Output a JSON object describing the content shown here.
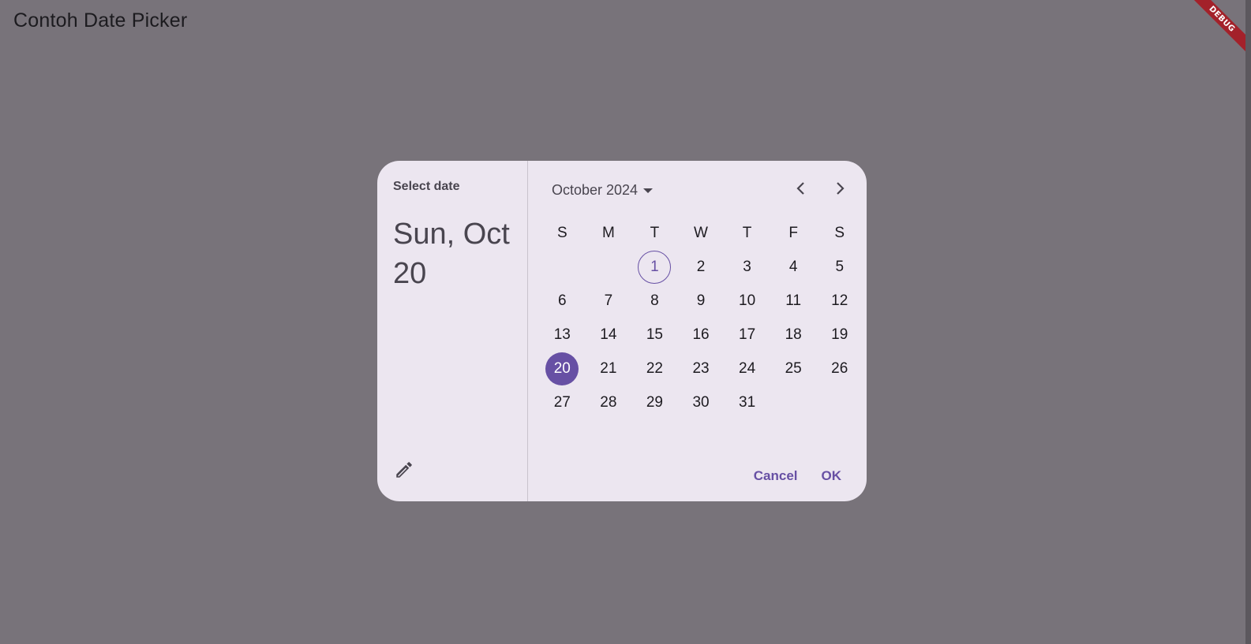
{
  "app": {
    "title": "Contoh Date Picker",
    "debug_banner": "DEBUG"
  },
  "dialog": {
    "help_text": "Select date",
    "headline": "Sun, Oct 20",
    "month_label": "October 2024",
    "weekdays": [
      "S",
      "M",
      "T",
      "W",
      "T",
      "F",
      "S"
    ],
    "weeks": [
      [
        "",
        "",
        "1",
        "2",
        "3",
        "4",
        "5"
      ],
      [
        "6",
        "7",
        "8",
        "9",
        "10",
        "11",
        "12"
      ],
      [
        "13",
        "14",
        "15",
        "16",
        "17",
        "18",
        "19"
      ],
      [
        "20",
        "21",
        "22",
        "23",
        "24",
        "25",
        "26"
      ],
      [
        "27",
        "28",
        "29",
        "30",
        "31",
        "",
        ""
      ]
    ],
    "today": "1",
    "selected": "20",
    "cancel_label": "Cancel",
    "ok_label": "OK",
    "icons": {
      "edit": "pencil-icon",
      "dropdown": "dropdown-arrow-icon",
      "prev": "chevron-left-icon",
      "next": "chevron-right-icon"
    }
  },
  "colors": {
    "scrim_background": "#78737a",
    "dialog_surface": "#ece6f0",
    "primary": "#6750a4",
    "on_primary": "#ffffff",
    "on_surface": "#1d1b20",
    "on_surface_variant": "#49454f",
    "debug_banner": "#a3212a"
  }
}
